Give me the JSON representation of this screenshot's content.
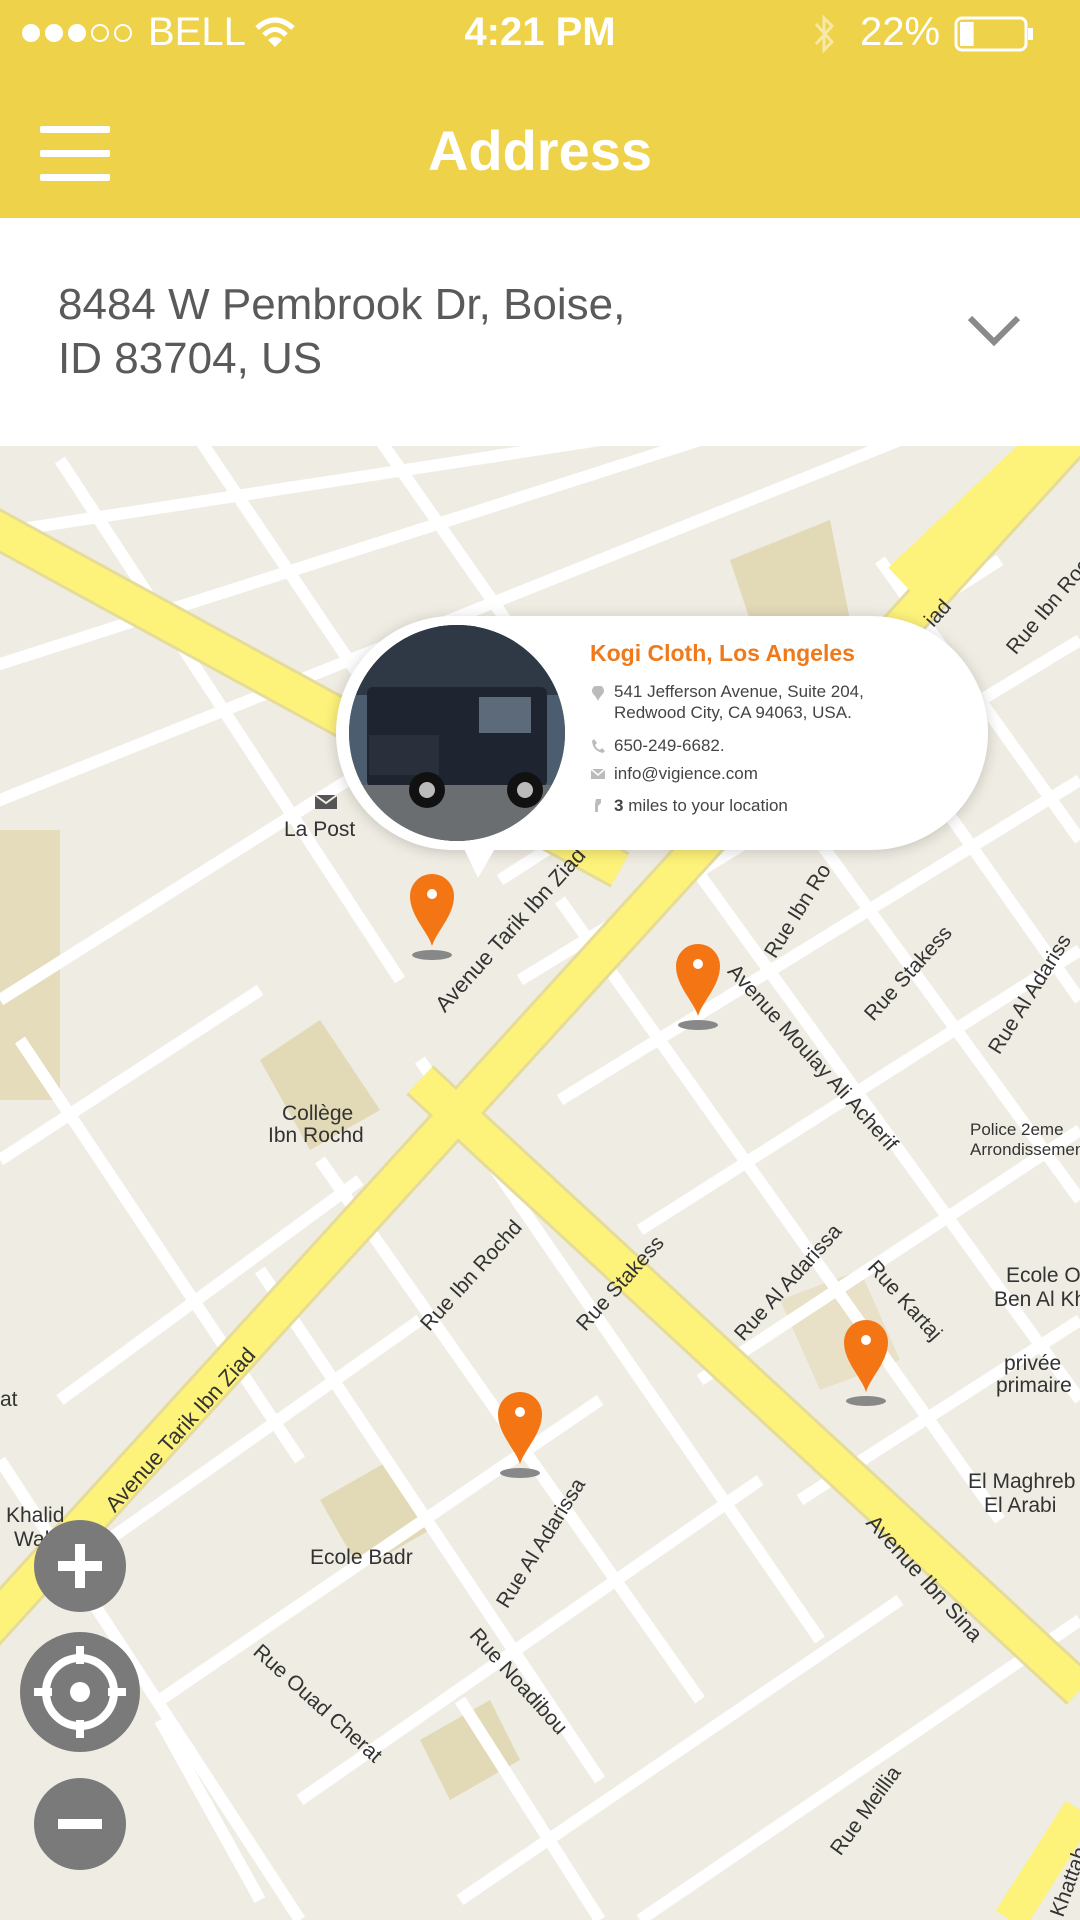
{
  "status_bar": {
    "carrier": "BELL",
    "time": "4:21 PM",
    "battery_percent": "22%",
    "battery_level": 0.22,
    "signal_bars_filled": 3,
    "signal_bars_total": 5
  },
  "nav": {
    "title": "Address"
  },
  "address": {
    "line1": "8484 W Pembrook Dr, Boise,",
    "line2": "ID 83704, US"
  },
  "map_labels": {
    "la_post": "La Post",
    "college": "Collège",
    "college2": "Ibn Rochd",
    "ave_tarik_1": "Avenue Tarik Ibn Ziad",
    "ave_tarik_2": "Avenue Tarik Ibn Ziad",
    "rue_ibn_rochd_top": "Rue Ibn Rochd",
    "rue_ibn_rochd": "Rue Ibn Rochd",
    "rue_stakess_1": "Rue Stakess",
    "rue_stakess_2": "Rue Stakess",
    "ave_moulay": "Avenue Moulay Ali Acherif",
    "rue_al_adarissa_1": "Rue Al Adarissa",
    "rue_al_adarissa_2": "Rue Al Adarissa",
    "rue_al_adarissa_3": "Rue Al Adariss",
    "police": "Police 2eme",
    "police2": "Arrondissemen",
    "rue_kartaj": "Rue Kartaj",
    "ecole_o": "Ecole O",
    "ben_al": "Ben Al Kh",
    "privee": "privée",
    "primaire": "primaire",
    "el_maghreb": "El Maghreb",
    "el_arabi": "El Arabi",
    "ave_ibn_sina": "Avenue Ibn Sina",
    "ecole_badr": "Ecole Badr",
    "rue_noadibou": "Rue Noadibou",
    "rue_ouad": "Rue Ouad Cherat",
    "rue_meillia": "Rue Meillia",
    "khalid": "Khalid",
    "walid": "Walid",
    "rue_ibn_r_top": "Rue Ibn Ro",
    "ziad_top": "iad",
    "khattab": "Khattab",
    "at": "at"
  },
  "callout": {
    "title": "Kogi Cloth, Los Angeles",
    "address_line1": "541 Jefferson Avenue, Suite 204,",
    "address_line2": "Redwood City, CA 94063, USA.",
    "phone": "650-249-6682.",
    "email": "info@vigience.com",
    "distance_value": "3",
    "distance_text": "miles to your location"
  },
  "colors": {
    "header_yellow": "#eed24a",
    "pin_orange": "#f47514",
    "callout_title": "#ef7a1c",
    "road_yellow": "#fdf27a",
    "control_gray": "#7a7a7a"
  },
  "icons": [
    "menu-icon",
    "wifi-icon",
    "bluetooth-icon",
    "battery-icon",
    "chevron-down-icon",
    "location-pin-icon",
    "phone-icon",
    "mail-icon",
    "walk-icon",
    "zoom-in-icon",
    "locate-icon",
    "zoom-out-icon"
  ]
}
